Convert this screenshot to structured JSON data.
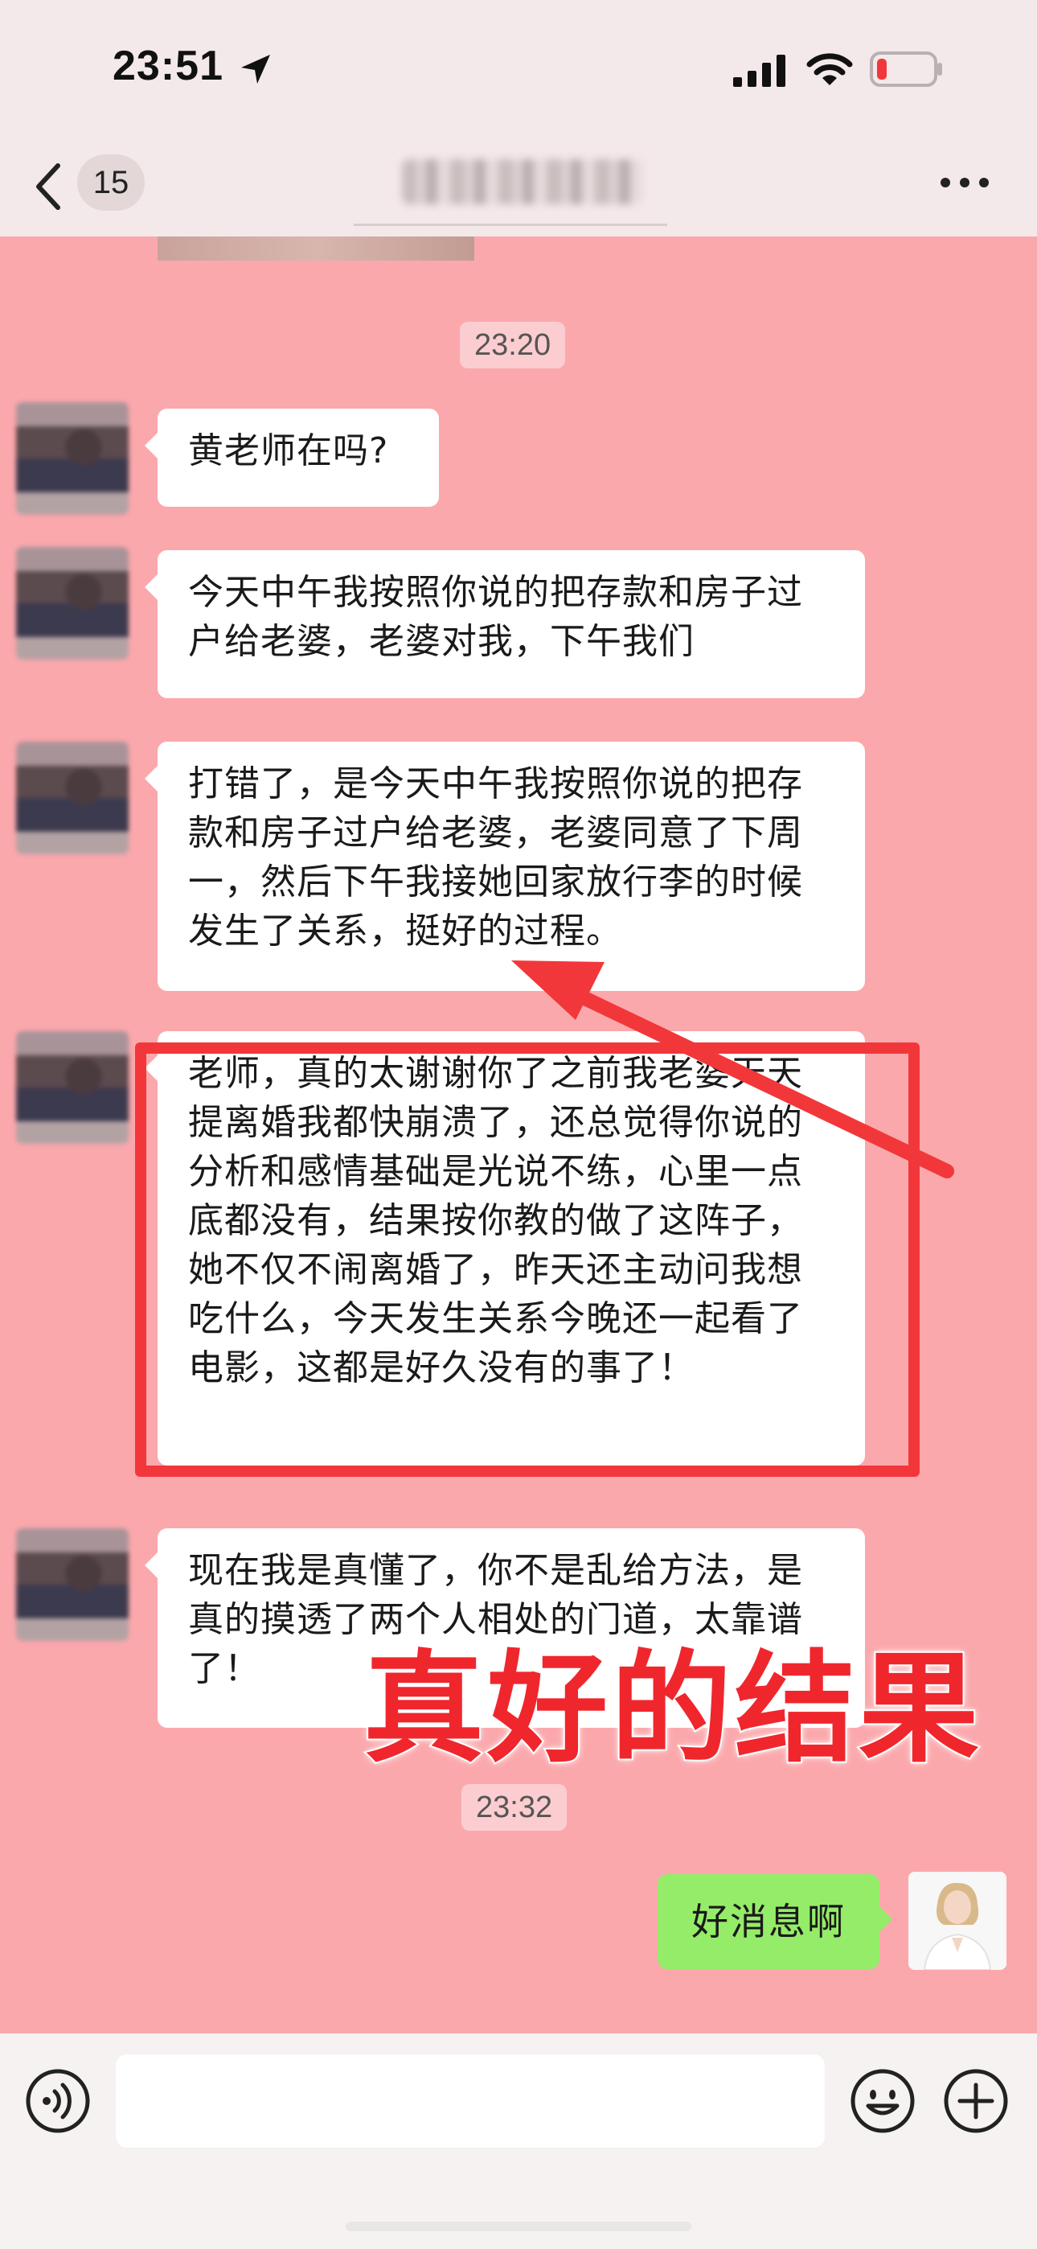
{
  "status_bar": {
    "time": "23:51",
    "icons": [
      "location-arrow-icon",
      "cellular-signal-icon",
      "wifi-icon",
      "battery-low-icon"
    ],
    "battery_color": "#f2373a"
  },
  "nav": {
    "unread_count": "15",
    "title": "",
    "icons": [
      "back-chevron-icon",
      "more-dots-icon"
    ]
  },
  "chat": {
    "background": "#fba8ac",
    "timestamps": [
      "23:20",
      "23:32"
    ],
    "incoming_messages": [
      "黄老师在吗?",
      "今天中午我按照你说的把存款和房子过户给老婆，老婆对我，下午我们",
      "打错了，是今天中午我按照你说的把存款和房子过户给老婆，老婆同意了下周一，然后下午我接她回家放行李的时候发生了关系，挺好的过程。",
      "老师，真的太谢谢你了之前我老婆天天提离婚我都快崩溃了，还总觉得你说的分析和感情基础是光说不练，心里一点底都没有，结果按你教的做了这阵子，她不仅不闹离婚了，昨天还主动问我想吃什么，今天发生关系今晚还一起看了电影，这都是好久没有的事了！",
      "现在我是真懂了，你不是乱给方法，是真的摸透了两个人相处的门道，太靠谱了！"
    ],
    "outgoing_messages": [
      "好消息啊"
    ],
    "bubble_colors": {
      "incoming": "#ffffff",
      "outgoing": "#95ec69"
    }
  },
  "annotations": {
    "caption": "真好的结果",
    "accent_color": "#f2373a"
  },
  "input_bar": {
    "icons": [
      "voice-icon",
      "emoji-icon",
      "plus-icon"
    ],
    "message_value": ""
  }
}
